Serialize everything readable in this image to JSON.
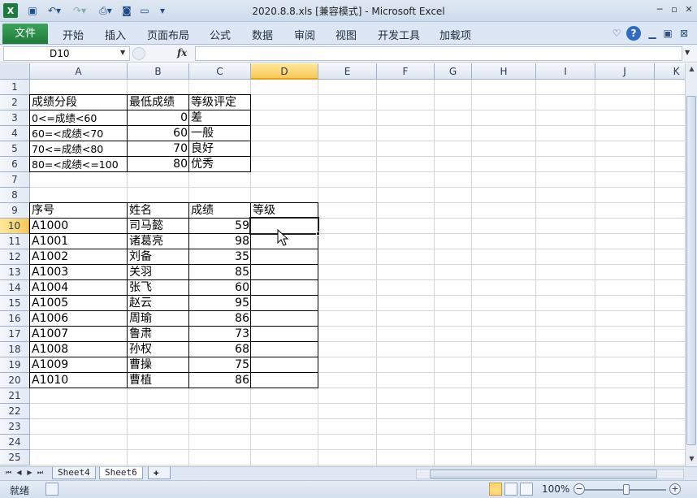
{
  "window": {
    "title": "2020.8.8.xls  [兼容模式]  -  Microsoft Excel",
    "app_icon": "excel-icon",
    "controls": {
      "minimize": "─",
      "restore": "▫",
      "close": "✕"
    }
  },
  "quick_access": {
    "save": "save-icon",
    "undo": "undo-icon",
    "redo": "redo-icon"
  },
  "ribbon": {
    "file_tab": "文件",
    "tabs": [
      "开始",
      "插入",
      "页面布局",
      "公式",
      "数据",
      "审阅",
      "视图",
      "开发工具",
      "加载项"
    ]
  },
  "formula_bar": {
    "name_box": "D10",
    "fx_label": "fx",
    "formula": ""
  },
  "columns": [
    "A",
    "B",
    "C",
    "D",
    "E",
    "F",
    "G",
    "H",
    "I",
    "J",
    "K"
  ],
  "rows": [
    "1",
    "2",
    "3",
    "4",
    "5",
    "6",
    "7",
    "8",
    "9",
    "10",
    "11",
    "12",
    "13",
    "14",
    "15",
    "16",
    "17",
    "18",
    "19",
    "20",
    "21",
    "22",
    "23",
    "24",
    "25"
  ],
  "selected_cell": "D10",
  "grade_table": {
    "headers": [
      "成绩分段",
      "最低成绩",
      "等级评定"
    ],
    "rows": [
      [
        "0<=成绩<60",
        "0",
        "差"
      ],
      [
        "60=<成绩<70",
        "60",
        "一般"
      ],
      [
        "70<=成绩<80",
        "70",
        "良好"
      ],
      [
        "80=<成绩<=100",
        "80",
        "优秀"
      ]
    ]
  },
  "score_table": {
    "headers": [
      "序号",
      "姓名",
      "成绩",
      "等级"
    ],
    "rows": [
      [
        "A1000",
        "司马懿",
        "59",
        ""
      ],
      [
        "A1001",
        "诸葛亮",
        "98",
        ""
      ],
      [
        "A1002",
        "刘备",
        "35",
        ""
      ],
      [
        "A1003",
        "关羽",
        "85",
        ""
      ],
      [
        "A1004",
        "张飞",
        "60",
        ""
      ],
      [
        "A1005",
        "赵云",
        "95",
        ""
      ],
      [
        "A1006",
        "周瑜",
        "86",
        ""
      ],
      [
        "A1007",
        "鲁肃",
        "73",
        ""
      ],
      [
        "A1008",
        "孙权",
        "68",
        ""
      ],
      [
        "A1009",
        "曹操",
        "75",
        ""
      ],
      [
        "A1010",
        "曹植",
        "86",
        ""
      ]
    ]
  },
  "sheets": [
    "Sheet4",
    "Sheet6"
  ],
  "status": {
    "text": "就绪",
    "zoom": "100%",
    "zoom_fraction": 0.5
  }
}
